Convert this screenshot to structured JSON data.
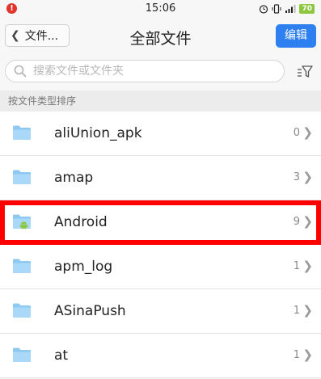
{
  "status_bar": {
    "notification_badge": "!",
    "time": "15:06",
    "icons": [
      "alarm-icon",
      "vibrate-icon",
      "signal-icon",
      "battery-icon"
    ],
    "battery_level": "70"
  },
  "nav": {
    "back_label": "文件...",
    "title": "全部文件",
    "edit_label": "编辑"
  },
  "search": {
    "placeholder": "搜索文件或文件夹",
    "value": ""
  },
  "section": {
    "header": "按文件类型排序"
  },
  "files": [
    {
      "name": "aliUnion_apk",
      "count": "0",
      "icon": "folder-icon"
    },
    {
      "name": "amap",
      "count": "3",
      "icon": "folder-icon"
    },
    {
      "name": "Android",
      "count": "9",
      "icon": "android-folder-icon",
      "highlighted": true
    },
    {
      "name": "apm_log",
      "count": "1",
      "icon": "folder-icon"
    },
    {
      "name": "ASinaPush",
      "count": "1",
      "icon": "folder-icon"
    },
    {
      "name": "at",
      "count": "1",
      "icon": "folder-icon"
    }
  ],
  "colors": {
    "accent": "#2e7ff0",
    "folder": "#8ec9f2",
    "highlight": "#ff0000",
    "android": "#8dc63f"
  }
}
